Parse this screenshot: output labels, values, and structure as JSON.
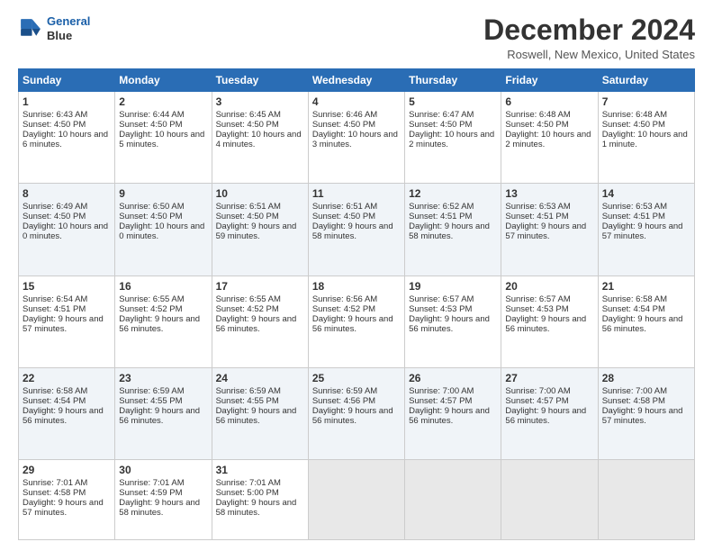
{
  "logo": {
    "line1": "General",
    "line2": "Blue"
  },
  "title": "December 2024",
  "location": "Roswell, New Mexico, United States",
  "days_header": [
    "Sunday",
    "Monday",
    "Tuesday",
    "Wednesday",
    "Thursday",
    "Friday",
    "Saturday"
  ],
  "weeks": [
    [
      {
        "day": "1",
        "sunrise": "6:43 AM",
        "sunset": "4:50 PM",
        "daylight": "10 hours and 6 minutes."
      },
      {
        "day": "2",
        "sunrise": "6:44 AM",
        "sunset": "4:50 PM",
        "daylight": "10 hours and 5 minutes."
      },
      {
        "day": "3",
        "sunrise": "6:45 AM",
        "sunset": "4:50 PM",
        "daylight": "10 hours and 4 minutes."
      },
      {
        "day": "4",
        "sunrise": "6:46 AM",
        "sunset": "4:50 PM",
        "daylight": "10 hours and 3 minutes."
      },
      {
        "day": "5",
        "sunrise": "6:47 AM",
        "sunset": "4:50 PM",
        "daylight": "10 hours and 2 minutes."
      },
      {
        "day": "6",
        "sunrise": "6:48 AM",
        "sunset": "4:50 PM",
        "daylight": "10 hours and 2 minutes."
      },
      {
        "day": "7",
        "sunrise": "6:48 AM",
        "sunset": "4:50 PM",
        "daylight": "10 hours and 1 minute."
      }
    ],
    [
      {
        "day": "8",
        "sunrise": "6:49 AM",
        "sunset": "4:50 PM",
        "daylight": "10 hours and 0 minutes."
      },
      {
        "day": "9",
        "sunrise": "6:50 AM",
        "sunset": "4:50 PM",
        "daylight": "10 hours and 0 minutes."
      },
      {
        "day": "10",
        "sunrise": "6:51 AM",
        "sunset": "4:50 PM",
        "daylight": "9 hours and 59 minutes."
      },
      {
        "day": "11",
        "sunrise": "6:51 AM",
        "sunset": "4:50 PM",
        "daylight": "9 hours and 58 minutes."
      },
      {
        "day": "12",
        "sunrise": "6:52 AM",
        "sunset": "4:51 PM",
        "daylight": "9 hours and 58 minutes."
      },
      {
        "day": "13",
        "sunrise": "6:53 AM",
        "sunset": "4:51 PM",
        "daylight": "9 hours and 57 minutes."
      },
      {
        "day": "14",
        "sunrise": "6:53 AM",
        "sunset": "4:51 PM",
        "daylight": "9 hours and 57 minutes."
      }
    ],
    [
      {
        "day": "15",
        "sunrise": "6:54 AM",
        "sunset": "4:51 PM",
        "daylight": "9 hours and 57 minutes."
      },
      {
        "day": "16",
        "sunrise": "6:55 AM",
        "sunset": "4:52 PM",
        "daylight": "9 hours and 56 minutes."
      },
      {
        "day": "17",
        "sunrise": "6:55 AM",
        "sunset": "4:52 PM",
        "daylight": "9 hours and 56 minutes."
      },
      {
        "day": "18",
        "sunrise": "6:56 AM",
        "sunset": "4:52 PM",
        "daylight": "9 hours and 56 minutes."
      },
      {
        "day": "19",
        "sunrise": "6:57 AM",
        "sunset": "4:53 PM",
        "daylight": "9 hours and 56 minutes."
      },
      {
        "day": "20",
        "sunrise": "6:57 AM",
        "sunset": "4:53 PM",
        "daylight": "9 hours and 56 minutes."
      },
      {
        "day": "21",
        "sunrise": "6:58 AM",
        "sunset": "4:54 PM",
        "daylight": "9 hours and 56 minutes."
      }
    ],
    [
      {
        "day": "22",
        "sunrise": "6:58 AM",
        "sunset": "4:54 PM",
        "daylight": "9 hours and 56 minutes."
      },
      {
        "day": "23",
        "sunrise": "6:59 AM",
        "sunset": "4:55 PM",
        "daylight": "9 hours and 56 minutes."
      },
      {
        "day": "24",
        "sunrise": "6:59 AM",
        "sunset": "4:55 PM",
        "daylight": "9 hours and 56 minutes."
      },
      {
        "day": "25",
        "sunrise": "6:59 AM",
        "sunset": "4:56 PM",
        "daylight": "9 hours and 56 minutes."
      },
      {
        "day": "26",
        "sunrise": "7:00 AM",
        "sunset": "4:57 PM",
        "daylight": "9 hours and 56 minutes."
      },
      {
        "day": "27",
        "sunrise": "7:00 AM",
        "sunset": "4:57 PM",
        "daylight": "9 hours and 56 minutes."
      },
      {
        "day": "28",
        "sunrise": "7:00 AM",
        "sunset": "4:58 PM",
        "daylight": "9 hours and 57 minutes."
      }
    ],
    [
      {
        "day": "29",
        "sunrise": "7:01 AM",
        "sunset": "4:58 PM",
        "daylight": "9 hours and 57 minutes."
      },
      {
        "day": "30",
        "sunrise": "7:01 AM",
        "sunset": "4:59 PM",
        "daylight": "9 hours and 58 minutes."
      },
      {
        "day": "31",
        "sunrise": "7:01 AM",
        "sunset": "5:00 PM",
        "daylight": "9 hours and 58 minutes."
      },
      null,
      null,
      null,
      null
    ]
  ]
}
